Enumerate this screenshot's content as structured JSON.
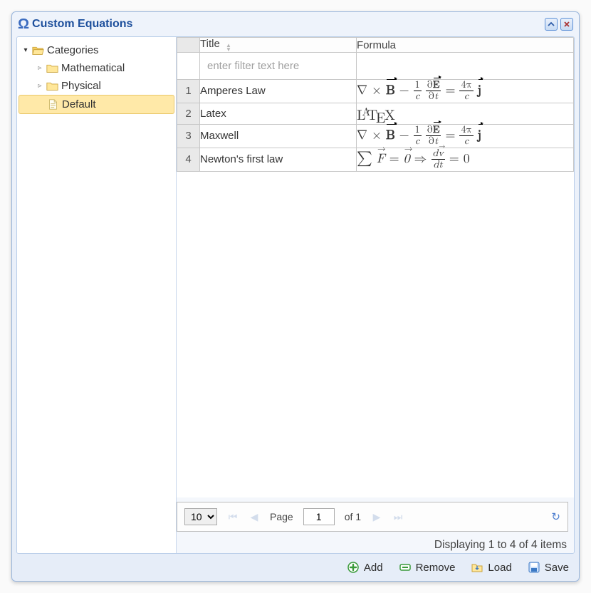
{
  "window": {
    "title": "Custom Equations"
  },
  "sidebar": {
    "root_label": "Categories",
    "items": [
      {
        "label": "Mathematical",
        "selected": false
      },
      {
        "label": "Physical",
        "selected": false
      },
      {
        "label": "Default",
        "selected": true
      }
    ]
  },
  "grid": {
    "columns": {
      "title": "Title",
      "formula": "Formula"
    },
    "filter_placeholder": "enter filter text here",
    "rows": [
      {
        "n": "1",
        "title": "Amperes Law",
        "formula_kind": "ampere"
      },
      {
        "n": "2",
        "title": "Latex",
        "formula_kind": "latex"
      },
      {
        "n": "3",
        "title": "Maxwell",
        "formula_kind": "ampere"
      },
      {
        "n": "4",
        "title": "Newton's first law",
        "formula_kind": "newton"
      }
    ]
  },
  "pager": {
    "page_size": "10",
    "page_label": "Page",
    "page_current": "1",
    "page_of": "of 1"
  },
  "status": "Displaying 1 to 4 of 4 items",
  "toolbar": {
    "add": "Add",
    "remove": "Remove",
    "load": "Load",
    "save": "Save"
  }
}
